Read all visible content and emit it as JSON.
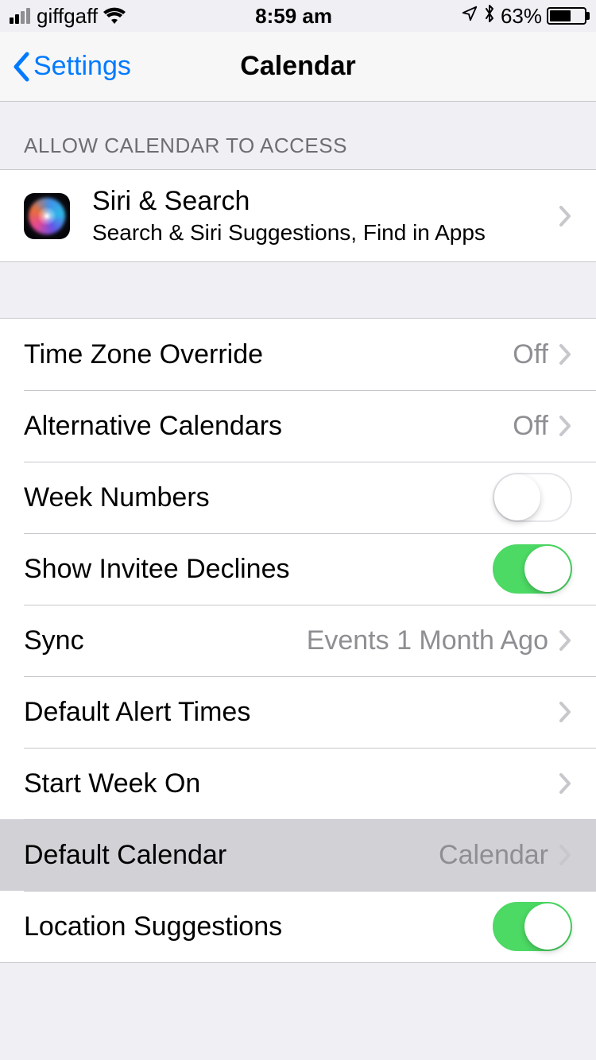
{
  "status": {
    "carrier": "giffgaff",
    "time": "8:59 am",
    "battery_pct": "63%"
  },
  "nav": {
    "back_label": "Settings",
    "title": "Calendar"
  },
  "section1": {
    "header": "ALLOW CALENDAR TO ACCESS",
    "siri": {
      "title": "Siri & Search",
      "subtitle": "Search & Siri Suggestions, Find in Apps"
    }
  },
  "rows": {
    "time_zone_override": {
      "label": "Time Zone Override",
      "value": "Off"
    },
    "alternative_calendars": {
      "label": "Alternative Calendars",
      "value": "Off"
    },
    "week_numbers": {
      "label": "Week Numbers",
      "on": false
    },
    "show_invitee_declines": {
      "label": "Show Invitee Declines",
      "on": true
    },
    "sync": {
      "label": "Sync",
      "value": "Events 1 Month Ago"
    },
    "default_alert_times": {
      "label": "Default Alert Times"
    },
    "start_week_on": {
      "label": "Start Week On"
    },
    "default_calendar": {
      "label": "Default Calendar",
      "value": "Calendar"
    },
    "location_suggestions": {
      "label": "Location Suggestions",
      "on": true
    }
  }
}
